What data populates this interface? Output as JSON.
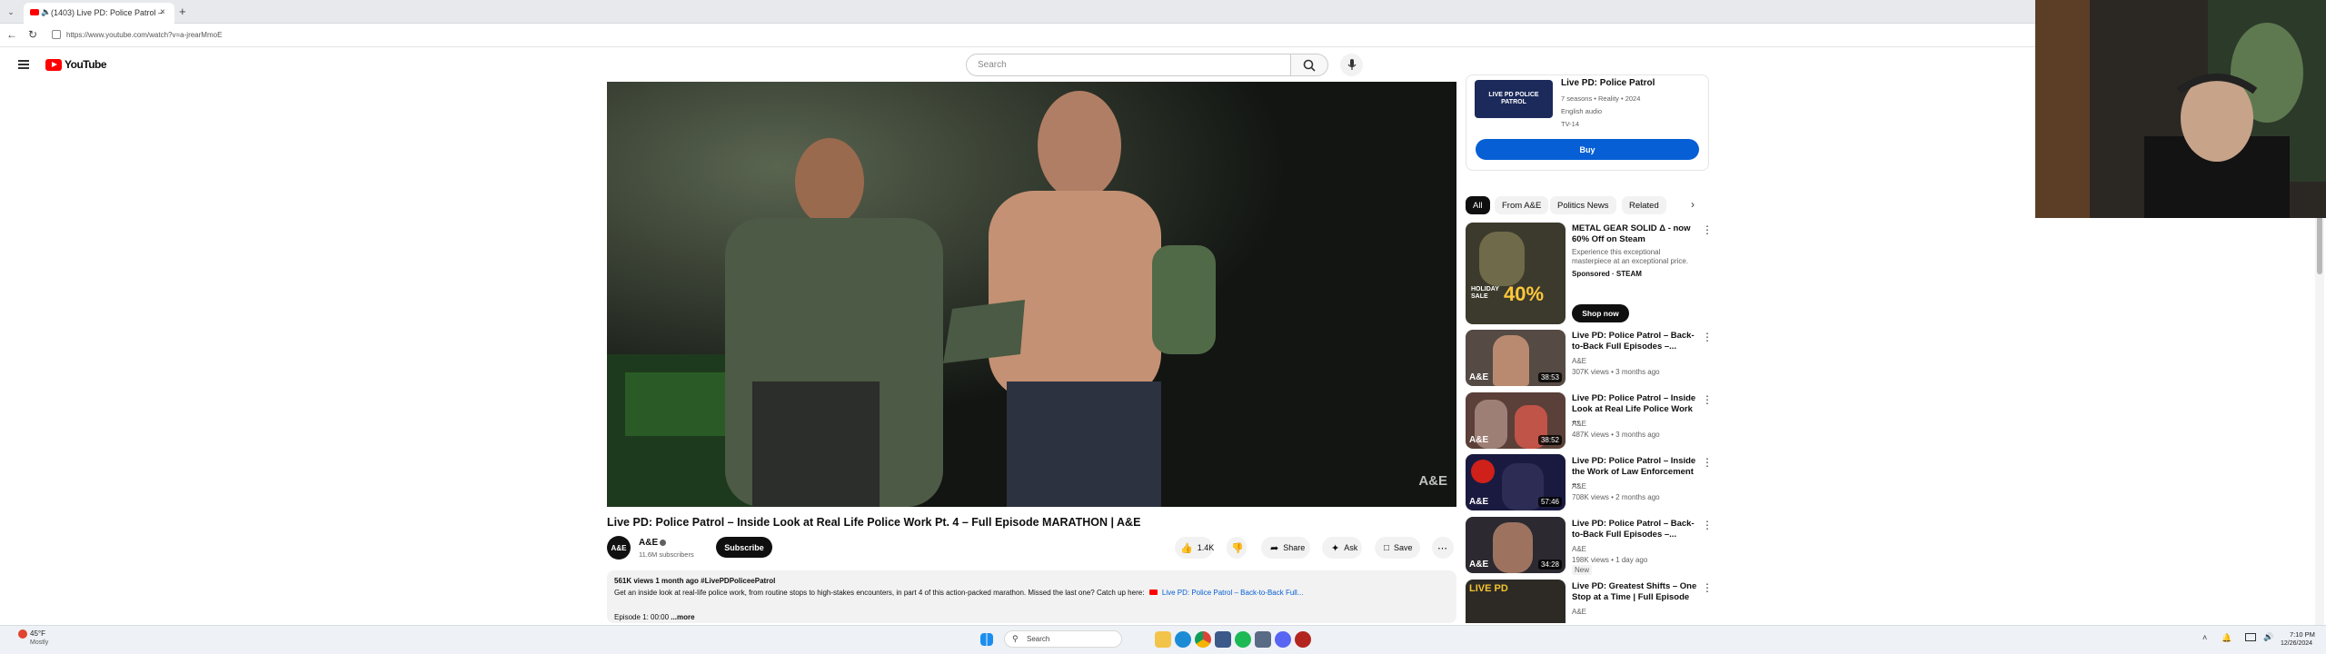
{
  "browser": {
    "tab_title": "(1403) Live PD: Police Patrol –",
    "url": "https://www.youtube.com/watch?v=a-jrearMmoE"
  },
  "header": {
    "logo_text": "YouTube",
    "search_placeholder": "Search"
  },
  "video": {
    "title": "Live PD: Police Patrol – Inside Look at Real Life Police Work Pt. 4 – Full Episode MARATHON | A&E",
    "watermark": "A&E"
  },
  "channel": {
    "avatar_text": "A&E",
    "name": "A&E",
    "subscribers": "11.6M subscribers",
    "subscribe_label": "Subscribe"
  },
  "actions": {
    "likes": "1.4K",
    "share": "Share",
    "ask": "Ask",
    "save": "Save"
  },
  "description": {
    "meta": "561K views  1 month ago  #LivePDPoliceePatrol",
    "text": "Get an inside look at real-life police work, from routine stops to high-stakes encounters, in part 4 of this action-packed marathon. Missed the last one? Catch up here:",
    "link": "Live PD: Police Patrol – Back-to-Back Full...",
    "episode": "Episode 1: 00:00",
    "more": "...more"
  },
  "show_card": {
    "title": "Live PD: Police Patrol",
    "line1": "7 seasons • Reality • 2024",
    "line2": "English audio",
    "line3": "TV-14",
    "thumb_text": "LIVE PD POLICE PATROL",
    "buy_label": "Buy"
  },
  "chips": [
    "All",
    "From A&E",
    "Politics News",
    "Related"
  ],
  "ad": {
    "title": "METAL GEAR SOLID Δ - now 60% Off on Steam",
    "desc": "Experience this exceptional masterpiece at an exceptional price.",
    "sponsor": "Sponsored · STEAM",
    "cta": "Shop now",
    "thumb_big": "40%",
    "thumb_small": "HOLIDAY SALE"
  },
  "recommendations": [
    {
      "title": "Live PD: Police Patrol – Back-to-Back Full Episodes –...",
      "channel": "A&E",
      "stats": "307K views • 3 months ago",
      "duration": "38:53"
    },
    {
      "title": "Live PD: Police Patrol – Inside Look at Real Life Police Work ...",
      "channel": "A&E",
      "stats": "487K views • 3 months ago",
      "duration": "38:52"
    },
    {
      "title": "Live PD: Police Patrol – Inside the Work of Law Enforcement ...",
      "channel": "A&E",
      "stats": "708K views • 2 months ago",
      "duration": "57:46"
    },
    {
      "title": "Live PD: Police Patrol – Back-to-Back Full Episodes –...",
      "channel": "A&E",
      "stats": "198K views • 1 day ago",
      "extra": "New",
      "duration": "34:28"
    },
    {
      "title": "Live PD: Greatest Shifts – One Stop at a Time | Full Episode",
      "channel": "A&E",
      "stats": "",
      "duration": ""
    }
  ],
  "taskbar": {
    "weather_temp": "45°F",
    "weather_desc": "Mostly",
    "search_label": "Search",
    "time": "7:10 PM",
    "date": "12/26/2024"
  },
  "colors": {
    "yt_red": "#ff0000",
    "buy_blue": "#065fd4",
    "subscribe_black": "#0f0f0f"
  }
}
